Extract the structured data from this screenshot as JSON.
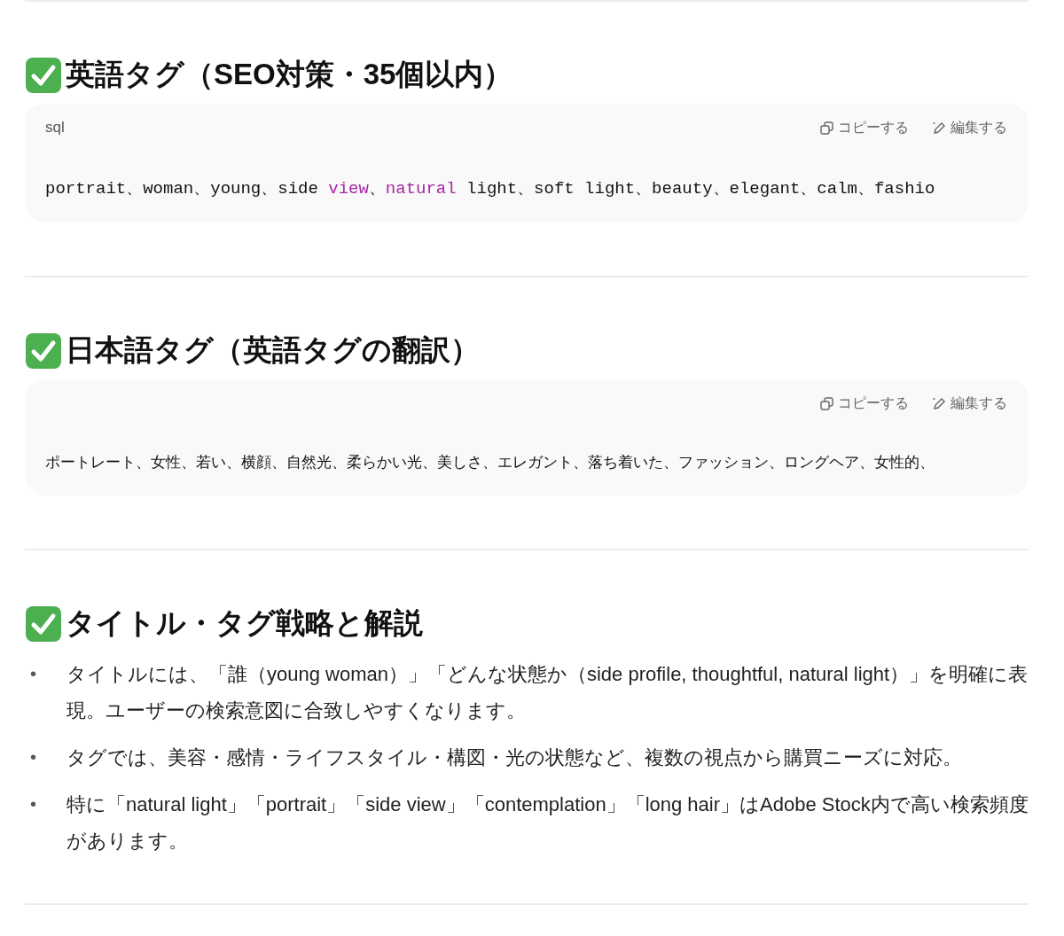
{
  "sections": [
    {
      "heading": "英語タグ（SEO対策・35個以内）",
      "code": {
        "language": "sql",
        "copy_label": "コピーする",
        "edit_label": "編集する",
        "tokens": [
          {
            "text": "portrait、woman、young、side ",
            "kind": "plain"
          },
          {
            "text": "view",
            "kind": "keyword"
          },
          {
            "text": "、",
            "kind": "plain"
          },
          {
            "text": "natural",
            "kind": "keyword"
          },
          {
            "text": " light、soft light、beauty、elegant、calm、fashio",
            "kind": "plain"
          }
        ]
      }
    },
    {
      "heading": "日本語タグ（英語タグの翻訳）",
      "code": {
        "copy_label": "コピーする",
        "edit_label": "編集する",
        "tokens": [
          {
            "text": "ポートレート、女性、若い、横顔、自然光、柔らかい光、美しさ、エレガント、落ち着いた、ファッション、ロングヘア、女性的、",
            "kind": "prose"
          }
        ]
      }
    },
    {
      "heading": "タイトル・タグ戦略と解説",
      "bullets": [
        {
          "marker": "•",
          "text": "タイトルには、「誰（young woman）」「どんな状態か（side profile, thoughtful, natural light）」を明確に表現。ユーザーの検索意図に合致しやすくなります。"
        },
        {
          "marker": "•",
          "text": "タグでは、美容・感情・ライフスタイル・構図・光の状態など、複数の視点から購買ニーズに対応。"
        },
        {
          "marker": "•",
          "text": "特に「natural light」「portrait」「side view」「contemplation」「long hair」はAdobe Stock内で高い検索頻度があります。"
        }
      ]
    }
  ]
}
